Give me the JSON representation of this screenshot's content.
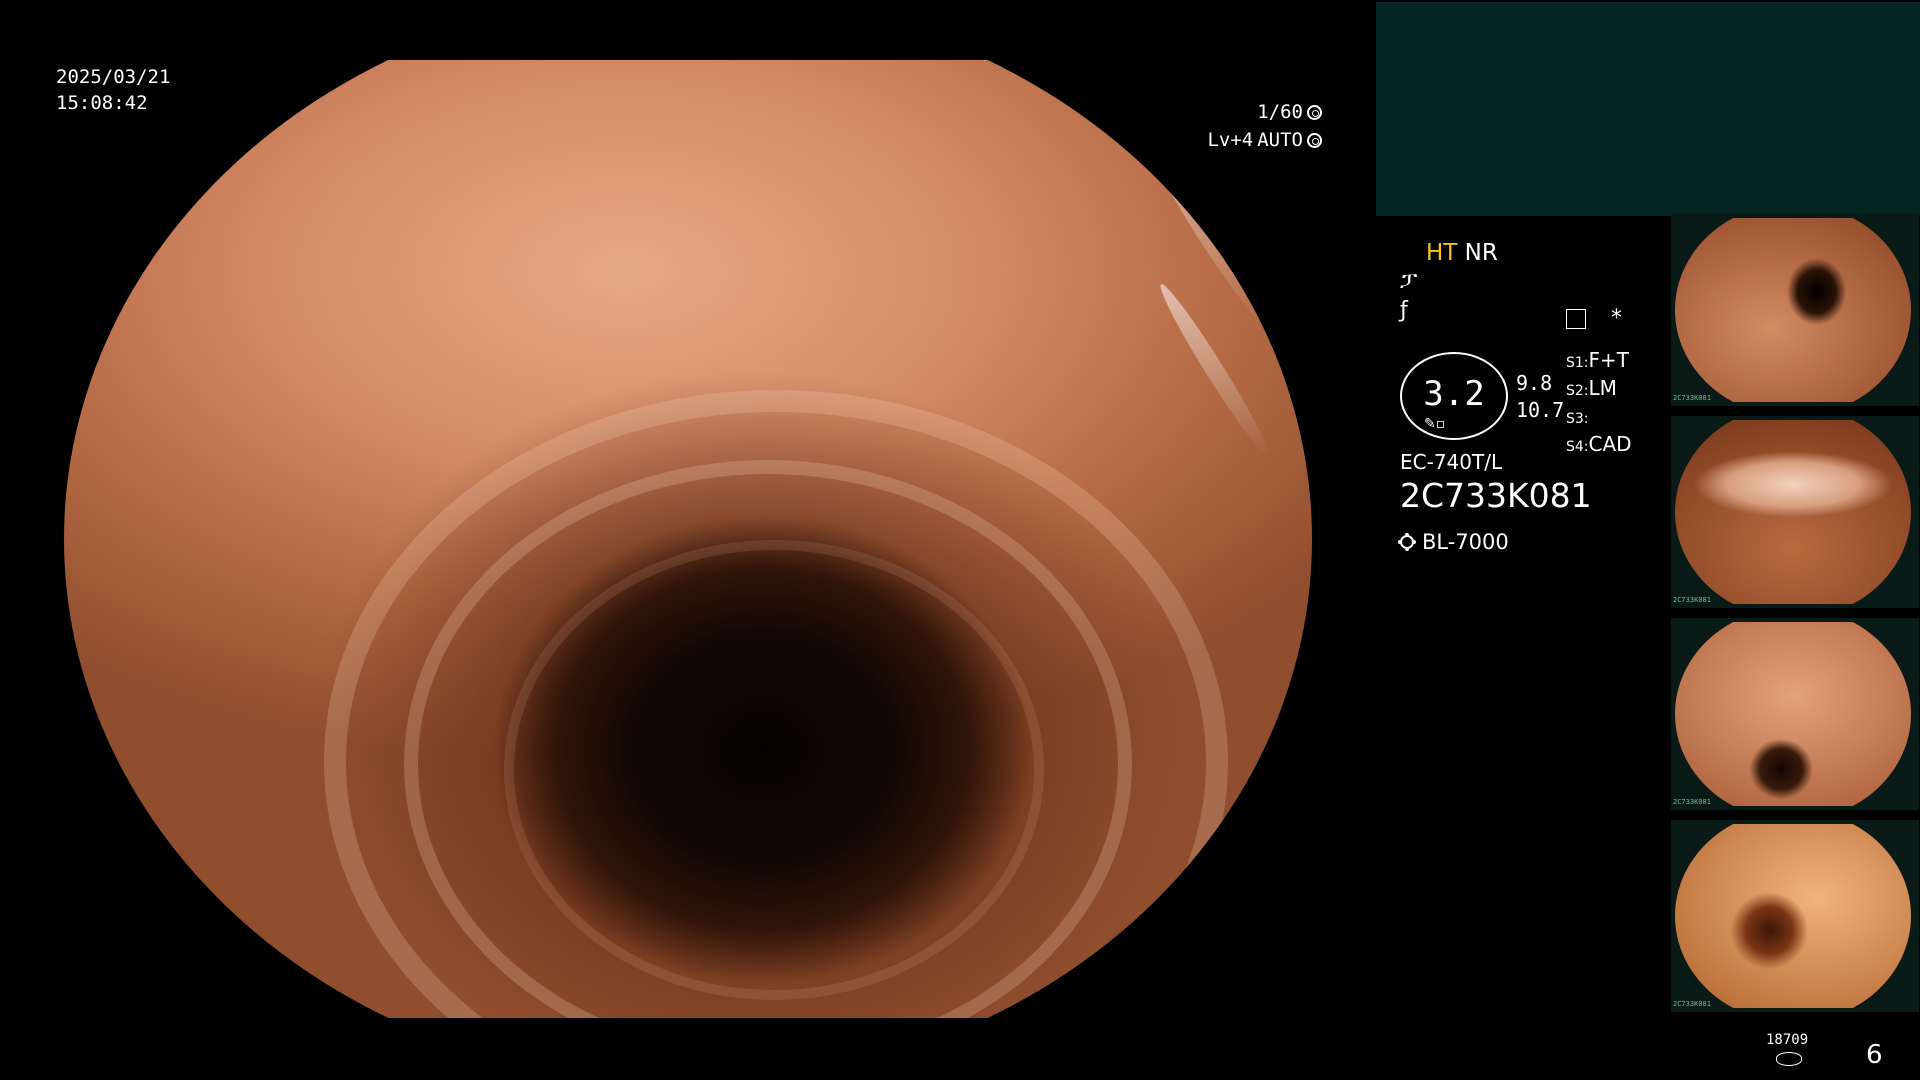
{
  "overlay": {
    "date": "2025/03/21",
    "time": "15:08:42",
    "shutter": "1/60",
    "level": "Lv+4",
    "mode": "AUTO"
  },
  "status": {
    "ht": "HT",
    "nr": "NR",
    "symbol1": "ፓ",
    "symbol2": "ƒ",
    "gauge_value": "3.2",
    "aux_value1": "9.8",
    "aux_value2": "10.7",
    "menu_star": "*"
  },
  "settings": [
    {
      "key": "S1:",
      "value": "F+T"
    },
    {
      "key": "S2:",
      "value": "LM"
    },
    {
      "key": "S3:",
      "value": ""
    },
    {
      "key": "S4:",
      "value": "CAD"
    }
  ],
  "scope": {
    "model": "EC-740T/L",
    "serial": "2C733K081",
    "light_source": "BL-7000"
  },
  "thumbnails": [
    {
      "label": "2C733K081"
    },
    {
      "label": "2C733K081"
    },
    {
      "label": "2C733K081"
    },
    {
      "label": "2C733K081"
    }
  ],
  "footer": {
    "storage_count": "18709",
    "page_number": "6"
  },
  "colors": {
    "ht": "#f7c31c",
    "panel_teal": "#052521"
  },
  "icons": {
    "shutter": "aperture-icon",
    "mode": "auto-iris-icon",
    "menu": "menu-list-icon",
    "light": "light-source-icon",
    "storage": "storage-disk-icon"
  }
}
